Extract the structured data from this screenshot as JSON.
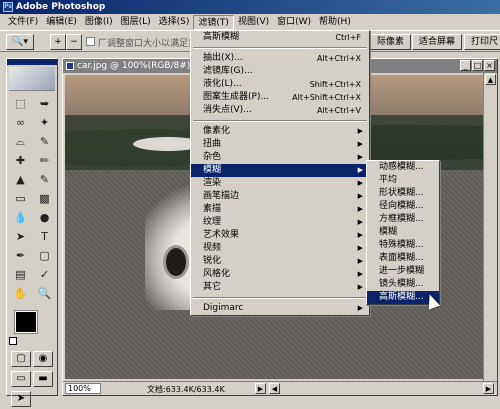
{
  "titlebar": {
    "title": "Adobe Photoshop",
    "icon": "photoshop-icon"
  },
  "menubar": {
    "items": [
      {
        "label": "文件(F)"
      },
      {
        "label": "编辑(E)"
      },
      {
        "label": "图像(I)"
      },
      {
        "label": "图层(L)"
      },
      {
        "label": "选择(S)"
      },
      {
        "label": "滤镜(T)"
      },
      {
        "label": "视图(V)"
      },
      {
        "label": "窗口(W)"
      },
      {
        "label": "帮助(H)"
      }
    ],
    "active_index": 5
  },
  "optionsbar": {
    "tool_icon": "magnifier-icon",
    "zoom_in_icon": "zoom-in-icon",
    "zoom_out_icon": "zoom-out-icon",
    "resize_checkbox_label": "厂调整窗口大小以满足显",
    "buttons": {
      "actual_pixels": "际像素",
      "fit_screen": "适合屏幕",
      "print_size": "打印尺"
    }
  },
  "toolbox": {
    "tools": [
      "marquee-icon",
      "move-icon",
      "lasso-icon",
      "magic-wand-icon",
      "crop-icon",
      "slice-icon",
      "healing-icon",
      "brush-icon",
      "stamp-icon",
      "history-brush-icon",
      "eraser-icon",
      "gradient-icon",
      "blur-icon",
      "dodge-icon",
      "path-select-icon",
      "type-icon",
      "pen-icon",
      "shape-icon",
      "notes-icon",
      "eyedropper-icon",
      "hand-icon",
      "zoom-icon"
    ]
  },
  "document": {
    "title": "car.jpg @ 100%(RGB/8#)",
    "zoom": "100%",
    "info": "文档:633.4K/633.4K"
  },
  "filter_menu": {
    "items": [
      {
        "label": "高斯模糊",
        "shortcut": "Ctrl+F"
      },
      {
        "sep": true
      },
      {
        "label": "抽出(X)...",
        "shortcut": "Alt+Ctrl+X"
      },
      {
        "label": "滤镜库(G)..."
      },
      {
        "label": "液化(L)...",
        "shortcut": "Shift+Ctrl+X"
      },
      {
        "label": "图案生成器(P)...",
        "shortcut": "Alt+Shift+Ctrl+X"
      },
      {
        "label": "消失点(V)...",
        "shortcut": "Alt+Ctrl+V"
      },
      {
        "sep": true
      },
      {
        "label": "像素化",
        "sub": true
      },
      {
        "label": "扭曲",
        "sub": true
      },
      {
        "label": "杂色",
        "sub": true
      },
      {
        "label": "模糊",
        "sub": true,
        "hl": true
      },
      {
        "label": "渲染",
        "sub": true
      },
      {
        "label": "画笔描边",
        "sub": true
      },
      {
        "label": "素描",
        "sub": true
      },
      {
        "label": "纹理",
        "sub": true
      },
      {
        "label": "艺术效果",
        "sub": true
      },
      {
        "label": "视频",
        "sub": true
      },
      {
        "label": "锐化",
        "sub": true
      },
      {
        "label": "风格化",
        "sub": true
      },
      {
        "label": "其它",
        "sub": true
      },
      {
        "sep": true
      },
      {
        "label": "Digimarc",
        "sub": true
      }
    ]
  },
  "blur_menu": {
    "items": [
      {
        "label": "动感模糊..."
      },
      {
        "label": "平均"
      },
      {
        "label": "形状模糊..."
      },
      {
        "label": "径向模糊..."
      },
      {
        "label": "方框模糊..."
      },
      {
        "label": "模糊"
      },
      {
        "label": "特殊模糊..."
      },
      {
        "label": "表面模糊..."
      },
      {
        "label": "进一步模糊"
      },
      {
        "label": "镜头模糊..."
      },
      {
        "label": "高斯模糊...",
        "hl": true
      }
    ]
  }
}
